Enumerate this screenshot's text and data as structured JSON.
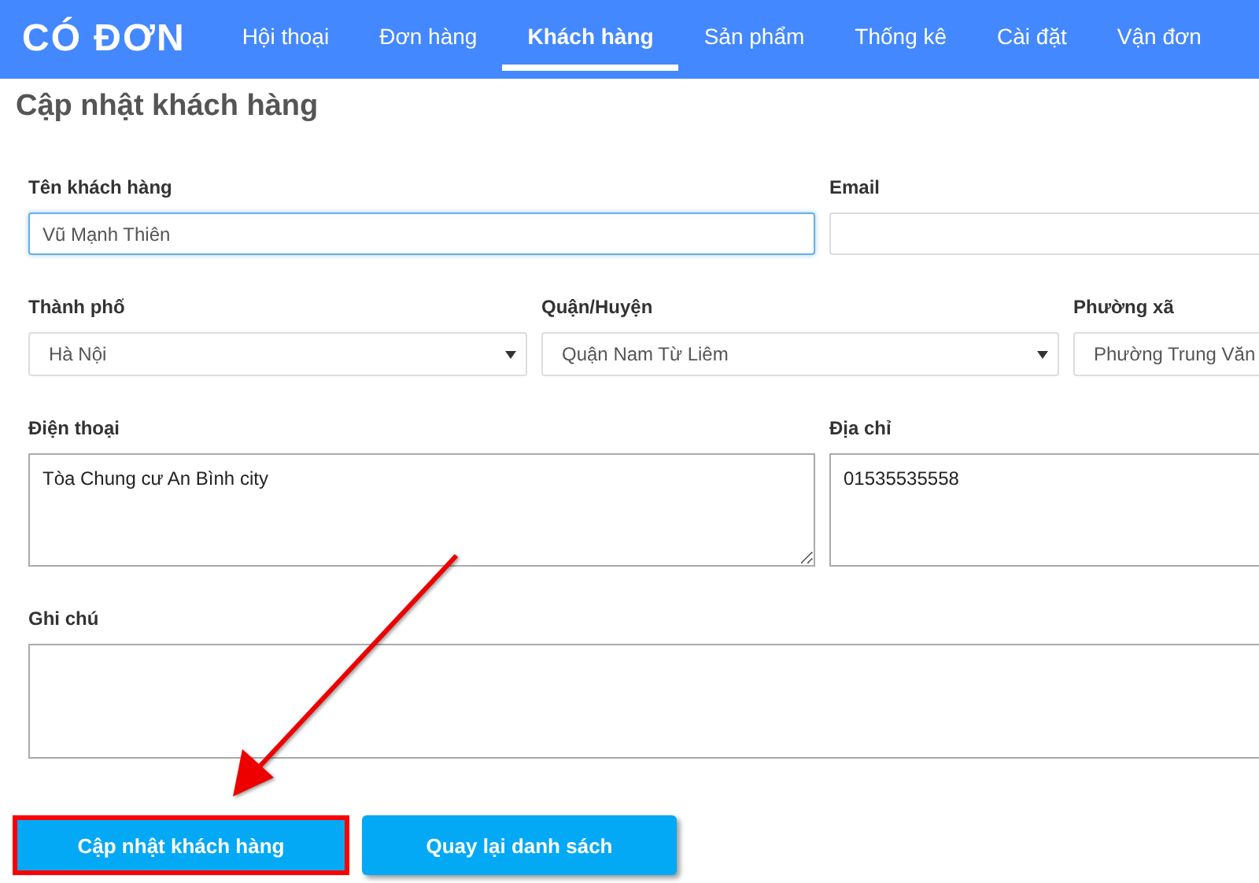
{
  "brand": "CÓ ĐƠN",
  "nav": [
    {
      "label": "Hội thoại",
      "selected": false
    },
    {
      "label": "Đơn hàng",
      "selected": false
    },
    {
      "label": "Khách hàng",
      "selected": true
    },
    {
      "label": "Sản phẩm",
      "selected": false
    },
    {
      "label": "Thống kê",
      "selected": false
    },
    {
      "label": "Cài đặt",
      "selected": false
    },
    {
      "label": "Vận đơn",
      "selected": false
    }
  ],
  "title": "Cập nhật khách hàng",
  "rows": [
    [
      {
        "kind": "input",
        "label": "Tên khách hàng",
        "value": "Vũ Mạnh Thiên",
        "focused": true
      },
      {
        "kind": "input",
        "label": "Email",
        "focused": false
      }
    ],
    [
      {
        "kind": "select",
        "label": "Thành phố",
        "value": "Hà Nội"
      },
      {
        "kind": "select",
        "label": "Quận/Huyện",
        "value": "Quận Nam Từ Liêm"
      },
      {
        "kind": "select",
        "label": "Phường xã",
        "value": "Phường Trung Văn"
      }
    ],
    [
      {
        "kind": "textarea",
        "label": "Điện thoại",
        "value": "Tòa Chung cư An Bình city"
      },
      {
        "kind": "textarea",
        "label": "Địa chỉ",
        "value": "01535535558"
      }
    ],
    [
      {
        "kind": "textarea",
        "label": "Ghi chú"
      }
    ]
  ],
  "buttons": [
    {
      "label": "Cập nhật khách hàng",
      "highlighted": true
    },
    {
      "label": "Quay lại danh sách",
      "highlighted": false
    }
  ]
}
